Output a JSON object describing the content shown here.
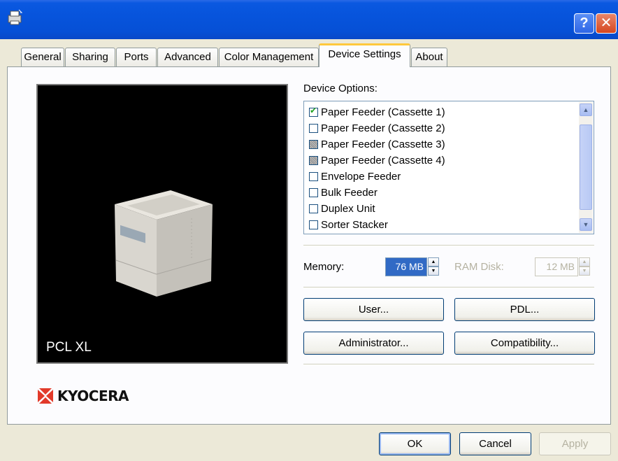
{
  "tabs": [
    "General",
    "Sharing",
    "Ports",
    "Advanced",
    "Color Management",
    "Device Settings",
    "About"
  ],
  "active_tab": "Device Settings",
  "preview": {
    "label": "PCL XL"
  },
  "logo": {
    "text": "KYOCERA"
  },
  "device_options": {
    "label": "Device Options:",
    "items": [
      {
        "label": "Paper Feeder (Cassette 1)",
        "state": "checked"
      },
      {
        "label": "Paper Feeder (Cassette 2)",
        "state": "unchecked"
      },
      {
        "label": "Paper Feeder (Cassette 3)",
        "state": "indeterminate"
      },
      {
        "label": "Paper Feeder (Cassette 4)",
        "state": "indeterminate"
      },
      {
        "label": "Envelope Feeder",
        "state": "unchecked"
      },
      {
        "label": "Bulk Feeder",
        "state": "unchecked"
      },
      {
        "label": "Duplex Unit",
        "state": "unchecked"
      },
      {
        "label": "Sorter Stacker",
        "state": "unchecked"
      }
    ]
  },
  "memory": {
    "label": "Memory:",
    "value": "76 MB"
  },
  "ram_disk": {
    "label": "RAM Disk:",
    "value": "12 MB"
  },
  "buttons": {
    "user": "User...",
    "pdl": "PDL...",
    "administrator": "Administrator...",
    "compatibility": "Compatibility...",
    "ok": "OK",
    "cancel": "Cancel",
    "apply": "Apply"
  },
  "colors": {
    "titlebar": "#0754dc",
    "selection": "#316ac5",
    "tab_highlight": "#ffc83c"
  }
}
